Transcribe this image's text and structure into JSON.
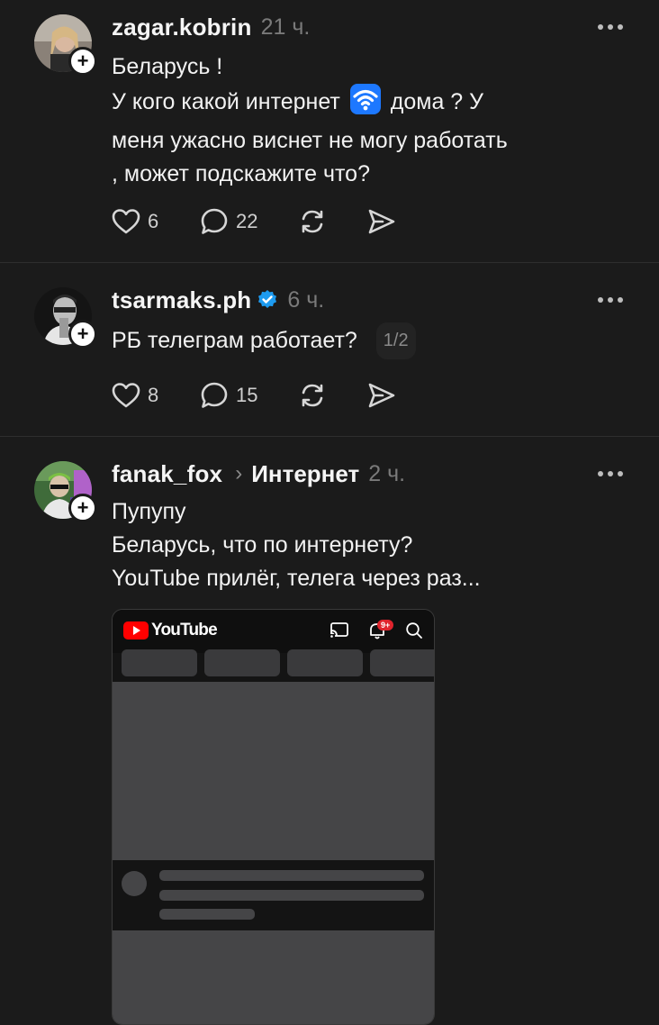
{
  "posts": [
    {
      "username": "zagar.kobrin",
      "time": "21 ч.",
      "text_line1": "Беларусь !",
      "text_line2_a": "У кого какой интернет",
      "text_line2_b": "дома ? У",
      "text_line3": "меня ужасно виснет не могу работать",
      "text_line4": ", может подскажите что?",
      "likes": "6",
      "comments": "22",
      "emoji_icon": "wifi-icon"
    },
    {
      "username": "tsarmaks.ph",
      "verified": true,
      "time": "6 ч.",
      "text": "РБ телеграм работает?",
      "pager": "1/2",
      "likes": "8",
      "comments": "15"
    },
    {
      "username": "fanak_fox",
      "topic": "Интернет",
      "time": "2 ч.",
      "text_line1": "Пупупу",
      "text_line2": "Беларусь, что по интернету?",
      "text_line3": "YouTube прилёг, телега через раз...",
      "attachment": {
        "app_name": "YouTube",
        "notification_count": "9+"
      }
    }
  ],
  "colors": {
    "background": "#1b1b1b",
    "verified": "#1d9bf0",
    "youtube_red": "#ff0000"
  }
}
